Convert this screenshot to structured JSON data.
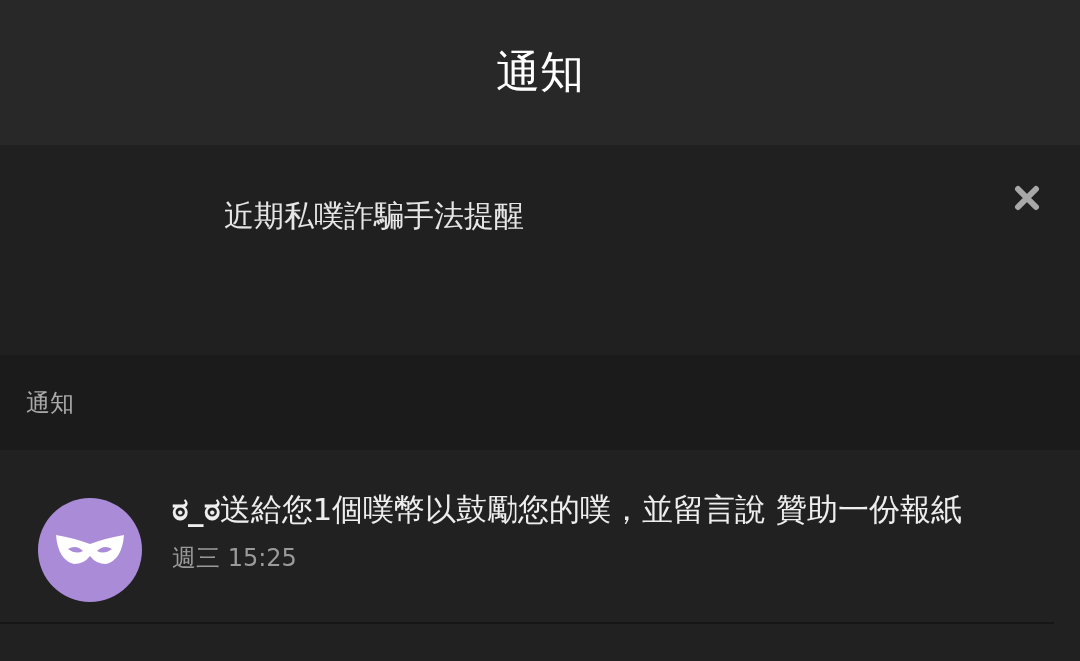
{
  "header": {
    "title": "通知"
  },
  "banner": {
    "text": "近期私噗詐騙手法提醒"
  },
  "section": {
    "label": "通知"
  },
  "notifications": [
    {
      "message": "**ಠ_ಠ**送給您1個噗幣以鼓勵您的噗，並留言說 贊助一份報紙",
      "time": "週三 15:25"
    }
  ]
}
